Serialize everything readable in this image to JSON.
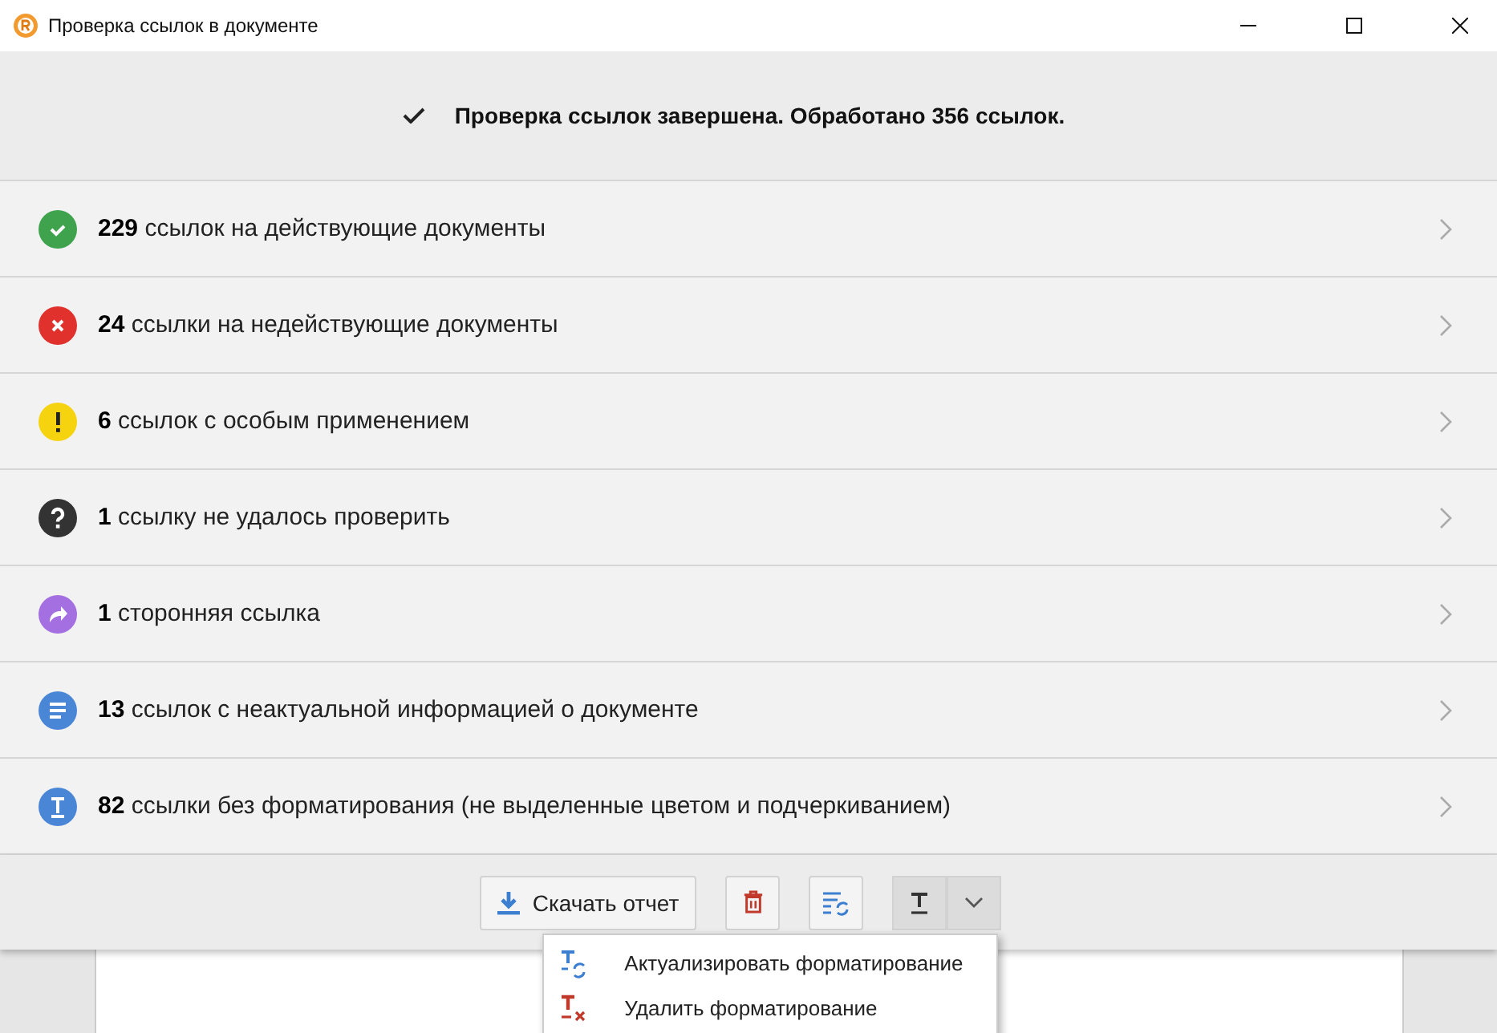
{
  "window": {
    "title": "Проверка ссылок в документе"
  },
  "summary": "Проверка ссылок завершена. Обработано 356 ссылок.",
  "results": [
    {
      "kind": "valid",
      "text": "**229** ссылок на действующие документы"
    },
    {
      "kind": "invalid",
      "text": "**24** ссылки на недействующие документы"
    },
    {
      "kind": "special",
      "text": "**6** ссылок с особым применением"
    },
    {
      "kind": "unknown",
      "text": "**1** ссылку не удалось проверить"
    },
    {
      "kind": "external",
      "text": "**1** сторонняя ссылка"
    },
    {
      "kind": "outdated",
      "text": "**13** ссылок с неактуальной информацией о документе"
    },
    {
      "kind": "unformatted",
      "text": "**82** ссылки без форматирования (не выделенные цветом и подчеркиванием)"
    }
  ],
  "toolbar": {
    "download": "Скачать отчет",
    "format_menu_expanded": true
  },
  "menu": [
    {
      "kind": "update",
      "label": "Актуализировать форматирование"
    },
    {
      "kind": "remove",
      "label": "Удалить форматирование"
    }
  ]
}
